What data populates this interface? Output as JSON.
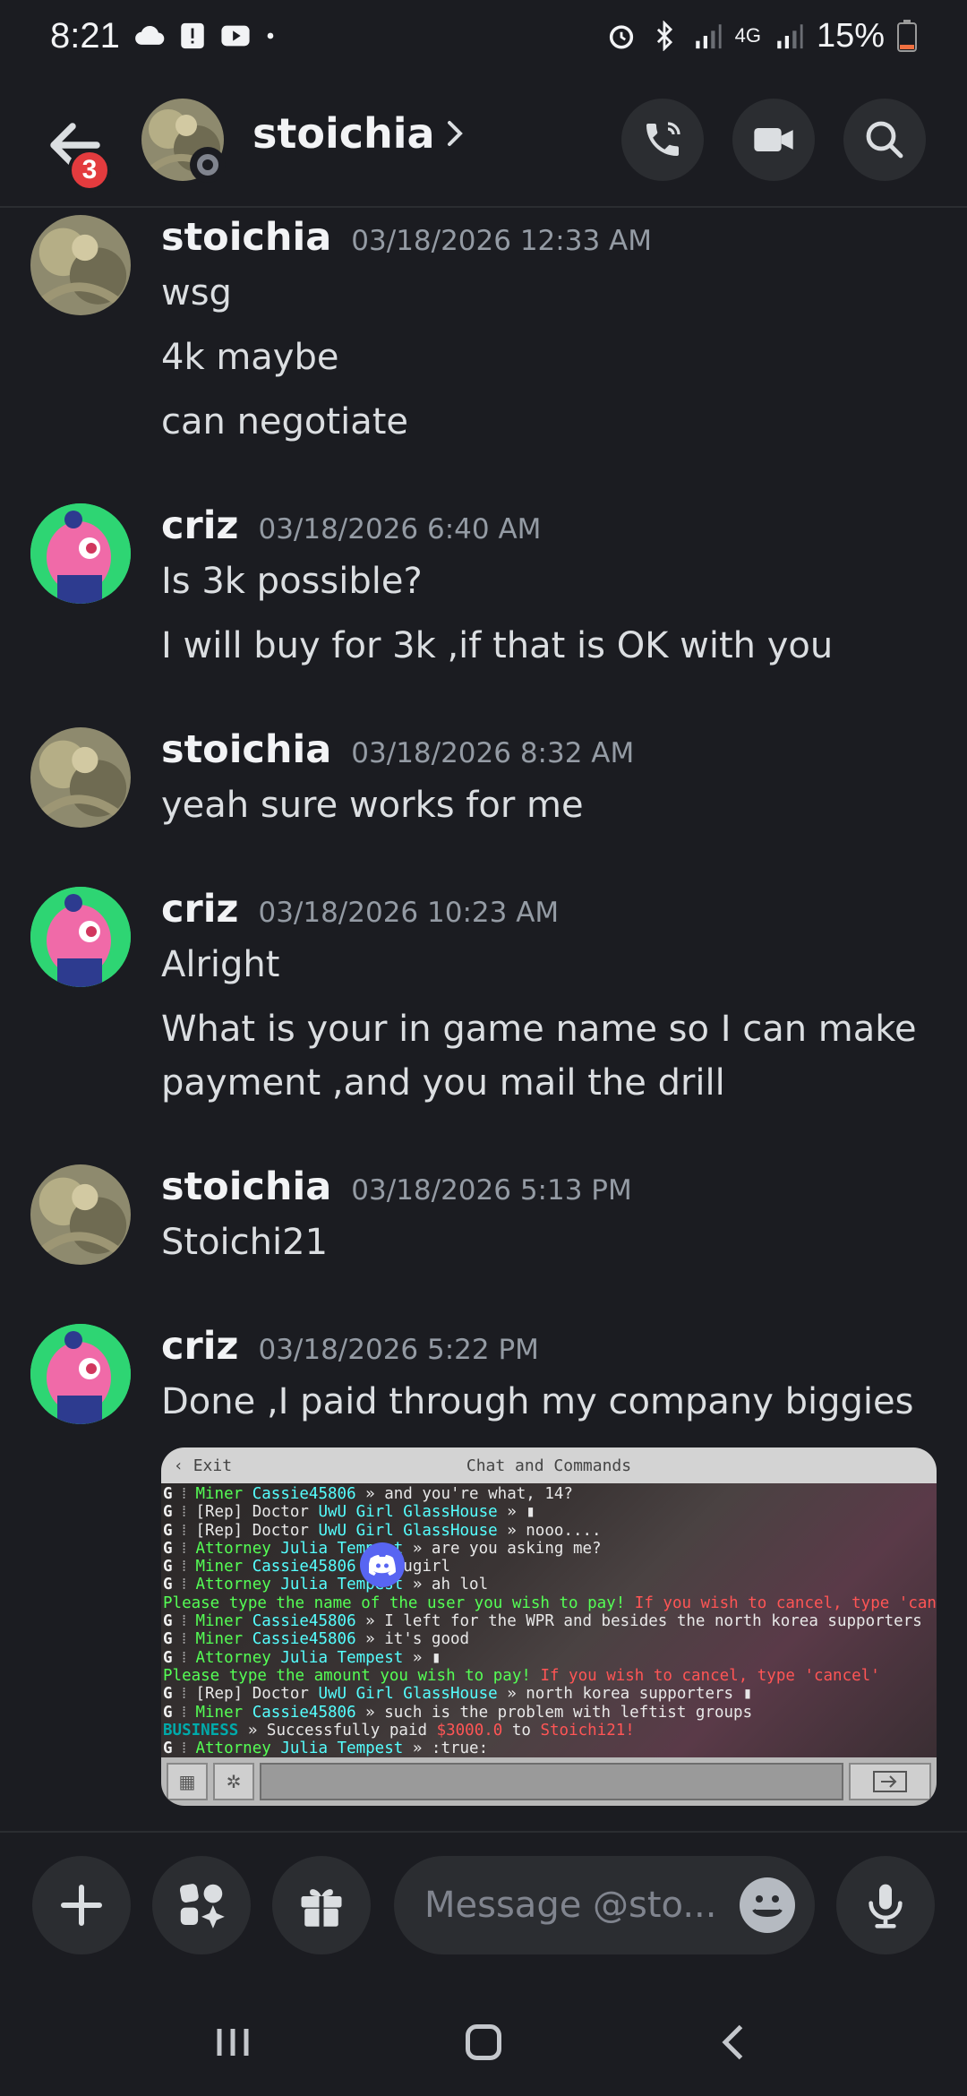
{
  "status_bar": {
    "time": "8:21",
    "battery": "15%",
    "network": "4G"
  },
  "header": {
    "name": "stoichia",
    "notification_count": "3"
  },
  "messages": [
    {
      "author": "stoichia",
      "timestamp": "03/18/2026 12:33 AM",
      "lines": [
        "wsg",
        "4k maybe",
        "can negotiate"
      ]
    },
    {
      "author": "criz",
      "timestamp": "03/18/2026 6:40 AM",
      "lines": [
        "Is 3k possible?",
        "I will buy for 3k ,if that is OK with you"
      ]
    },
    {
      "author": "stoichia",
      "timestamp": "03/18/2026 8:32 AM",
      "lines": [
        "yeah sure works for me"
      ]
    },
    {
      "author": "criz",
      "timestamp": "03/18/2026 10:23 AM",
      "lines": [
        "Alright",
        "What is your in game name so I can make",
        "payment  ,and you mail the drill"
      ]
    },
    {
      "author": "stoichia",
      "timestamp": "03/18/2026 5:13 PM",
      "lines": [
        "Stoichi21"
      ]
    },
    {
      "author": "criz",
      "timestamp": "03/18/2026 5:22 PM",
      "lines": [
        "Done ,I paid through  my company biggies"
      ]
    }
  ],
  "attachment": {
    "exit_label": "Exit",
    "title": "Chat and Commands",
    "chat_lines": [
      {
        "g": "G",
        "rank": "Miner",
        "user": "Cassie45806",
        "text": " » and you're what, 14?"
      },
      {
        "g": "G",
        "rank": "[Rep] Doctor",
        "user": "UwU Girl GlassHouse",
        "text": " » ▮"
      },
      {
        "g": "G",
        "rank": "[Rep] Doctor",
        "user": "UwU Girl GlassHouse",
        "text": " » nooo...."
      },
      {
        "g": "G",
        "rank": "Attorney",
        "user": "Julia Tempest",
        "text": " » are you asking me?"
      },
      {
        "g": "G",
        "rank": "Miner",
        "user": "Cassie45806",
        "text": " » uwugirl"
      },
      {
        "g": "G",
        "rank": "Attorney",
        "user": "Julia Tempest",
        "text": " » ah lol"
      },
      {
        "system_green": "Please type the name of the user you wish to pay!",
        "system_red": " If you wish to cancel, type 'cancel'"
      },
      {
        "g": "G",
        "rank": "Miner",
        "user": "Cassie45806",
        "text": " » I left for the WPR and besides the north korea supporters"
      },
      {
        "g": "G",
        "rank": "Miner",
        "user": "Cassie45806",
        "text": " » it's good"
      },
      {
        "g": "G",
        "rank": "Attorney",
        "user": "Julia Tempest",
        "text": " » ▮"
      },
      {
        "system_green": "Please type the amount you wish to pay!",
        "system_red": " If you wish to cancel, type 'cancel'"
      },
      {
        "g": "G",
        "rank": "[Rep] Doctor",
        "user": "UwU Girl GlassHouse",
        "text": " » north korea supporters ▮"
      },
      {
        "g": "G",
        "rank": "Miner",
        "user": "Cassie45806",
        "text": " » such is the problem with leftist groups"
      },
      {
        "business": "BUSINESS",
        "pay_text": " » Successfully paid ",
        "amount": "$3000.0",
        "to": " to ",
        "recipient": "Stoichi21!"
      },
      {
        "g": "G",
        "rank": "Attorney",
        "user": "Julia Tempest",
        "text": " » :true:"
      }
    ]
  },
  "composer": {
    "placeholder": "Message @sto..."
  },
  "colors": {
    "background": "#1b1c21",
    "surface": "#2b2d31",
    "badge": "#e33b3e",
    "criz_avatar": "#2ed573"
  }
}
